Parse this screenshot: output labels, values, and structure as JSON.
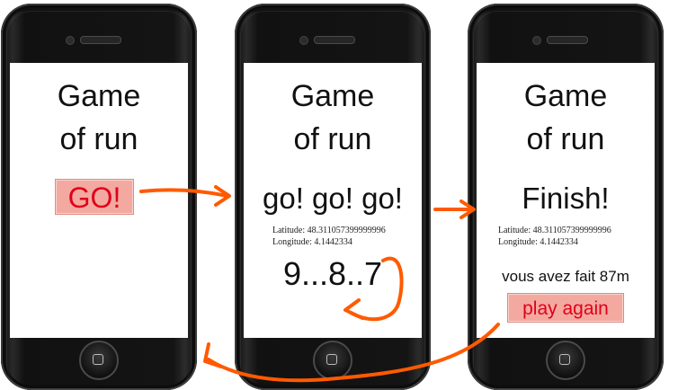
{
  "colors": {
    "arrow": "#ff5a00",
    "button_bg": "#f3a9a0",
    "button_text": "#e0001a"
  },
  "phone1": {
    "title_line1": "Game",
    "title_line2": "of run",
    "go_button": "GO!"
  },
  "phone2": {
    "title_line1": "Game",
    "title_line2": "of run",
    "status": "go! go! go!",
    "latitude": "Latitude: 48.311057399999996",
    "longitude": "Longitude: 4.1442334",
    "countdown": "9...8..7"
  },
  "phone3": {
    "title_line1": "Game",
    "title_line2": "of run",
    "status": "Finish!",
    "latitude": "Latitude: 48.311057399999996",
    "longitude": "Longitude: 4.1442334",
    "result": "vous avez fait 87m",
    "play_again_button": "play again"
  }
}
